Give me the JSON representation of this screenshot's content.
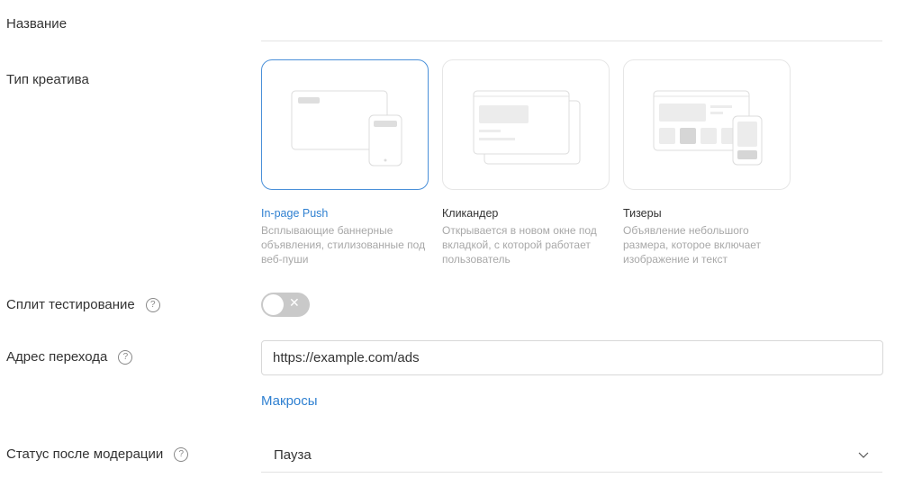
{
  "fields": {
    "name_label": "Название",
    "name_value": "",
    "creative_type_label": "Тип креатива",
    "split_test_label": "Сплит тестирование",
    "split_test_on": false,
    "url_label": "Адрес перехода",
    "url_value": "https://example.com/ads",
    "macros_link": "Макросы",
    "status_label": "Статус после модерации",
    "status_value": "Пауза",
    "help_glyph": "?"
  },
  "creative_types": [
    {
      "title": "In-page Push",
      "description": "Всплывающие баннерные объявления, стилизованные под веб-пуши",
      "selected": true
    },
    {
      "title": "Кликандер",
      "description": "Открывается в новом окне под вкладкой, с которой работает пользователь",
      "selected": false
    },
    {
      "title": "Тизеры",
      "description": "Объявление небольшого размера, которое включает изображение и текст",
      "selected": false
    }
  ],
  "colors": {
    "accent": "#2f80d1",
    "toggle_off": "#c9c9c9",
    "muted_text": "#a8a8a8"
  },
  "icons": {
    "help": "question-circle-icon",
    "toggle_off": "close-icon",
    "select": "chevron-down-icon"
  }
}
